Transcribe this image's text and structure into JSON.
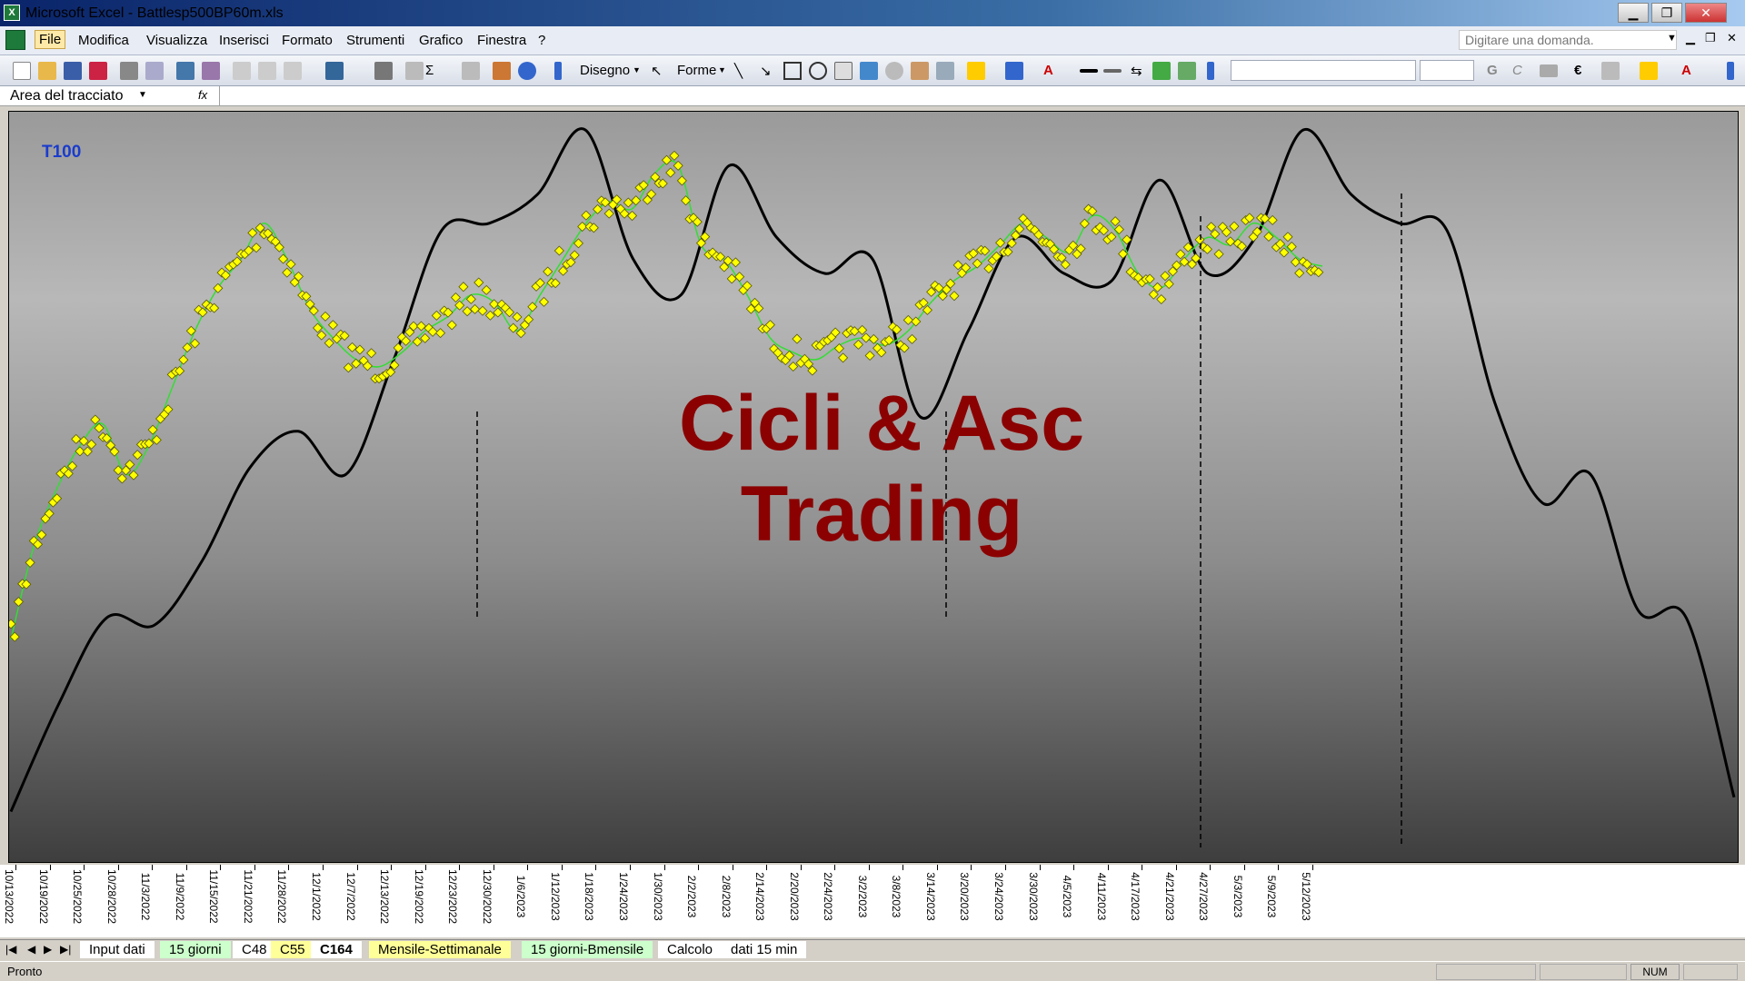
{
  "window": {
    "title": "Microsoft Excel - Battlesp500BP60m.xls",
    "minimize": "▁",
    "maximize": "❐",
    "close": "✕"
  },
  "menu": {
    "items": [
      "File",
      "Modifica",
      "Visualizza",
      "Inserisci",
      "Formato",
      "Strumenti",
      "Grafico",
      "Finestra",
      "?"
    ],
    "help_placeholder": "Digitare una domanda."
  },
  "toolbar": {
    "drawing_label": "Disegno",
    "shapes_label": "Forme",
    "bold_label": "G",
    "italic_label": "C",
    "euro_symbol": "€"
  },
  "namebox": {
    "value": "Area del tracciato",
    "fx": "fx"
  },
  "chart": {
    "series_label": "T100",
    "watermark_line1": "Cicli & Asc",
    "watermark_line2": "Trading",
    "colors": {
      "price": "#ffff00",
      "price_outline": "#5a5a00",
      "price_line": "#33dd33",
      "cycle": "#000000",
      "watermark": "#8b0000",
      "label": "#1a3ccc"
    }
  },
  "chart_data": {
    "type": "line",
    "x_tick_labels": [
      "10/13/2022",
      "10/19/2022",
      "10/25/2022",
      "10/28/2022",
      "11/3/2022",
      "11/9/2022",
      "11/15/2022",
      "11/21/2022",
      "11/28/2022",
      "12/1/2022",
      "12/7/2022",
      "12/13/2022",
      "12/19/2022",
      "12/23/2022",
      "12/30/2022",
      "1/6/2023",
      "1/12/2023",
      "1/18/2023",
      "1/24/2023",
      "1/30/2023",
      "2/2/2023",
      "2/8/2023",
      "2/14/2023",
      "2/20/2023",
      "2/24/2023",
      "3/2/2023",
      "3/8/2023",
      "3/14/2023",
      "3/20/2023",
      "3/24/2023",
      "3/30/2023",
      "4/5/2023",
      "4/11/2023",
      "4/17/2023",
      "4/21/2023",
      "4/27/2023",
      "5/3/2023",
      "5/9/2023",
      "5/12/2023"
    ],
    "series": [
      {
        "values": [
          0.29,
          0.42,
          0.5,
          0.56,
          0.59,
          0.52,
          0.56,
          0.64,
          0.72,
          0.78,
          0.82,
          0.87,
          0.82,
          0.75,
          0.71,
          0.68,
          0.67,
          0.69,
          0.72,
          0.74,
          0.77,
          0.76,
          0.72,
          0.77,
          0.82,
          0.87,
          0.9,
          0.89,
          0.94,
          0.95,
          0.84,
          0.82,
          0.77,
          0.71,
          0.69,
          0.68,
          0.7,
          0.71,
          0.7,
          0.72,
          0.76,
          0.79,
          0.81,
          0.84,
          0.87,
          0.85,
          0.83,
          0.88,
          0.86,
          0.8,
          0.78,
          0.82,
          0.85,
          0.84,
          0.87,
          0.85,
          0.82,
          0.81
        ]
      },
      {
        "values": [
          0.05,
          0.2,
          0.32,
          0.31,
          0.4,
          0.53,
          0.58,
          0.52,
          0.68,
          0.86,
          0.87,
          0.91,
          1.0,
          0.82,
          0.77,
          0.95,
          0.85,
          0.8,
          0.82,
          0.6,
          0.72,
          0.85,
          0.8,
          0.79,
          0.93,
          0.8,
          0.85,
          1.0,
          0.91,
          0.87,
          0.86,
          0.62,
          0.48,
          0.52,
          0.33,
          0.32,
          0.07
        ]
      }
    ],
    "y_range": [
      0,
      1
    ]
  },
  "sheet_tabs": {
    "tabs": [
      "Input dati",
      "15 giorni",
      "C48",
      "C55",
      "C164",
      "Mensile-Settimanale",
      "15 giorni-Bmensile",
      "Calcolo",
      "dati 15 min"
    ],
    "active": "C164"
  },
  "status": {
    "text": "Pronto",
    "num": "NUM"
  }
}
